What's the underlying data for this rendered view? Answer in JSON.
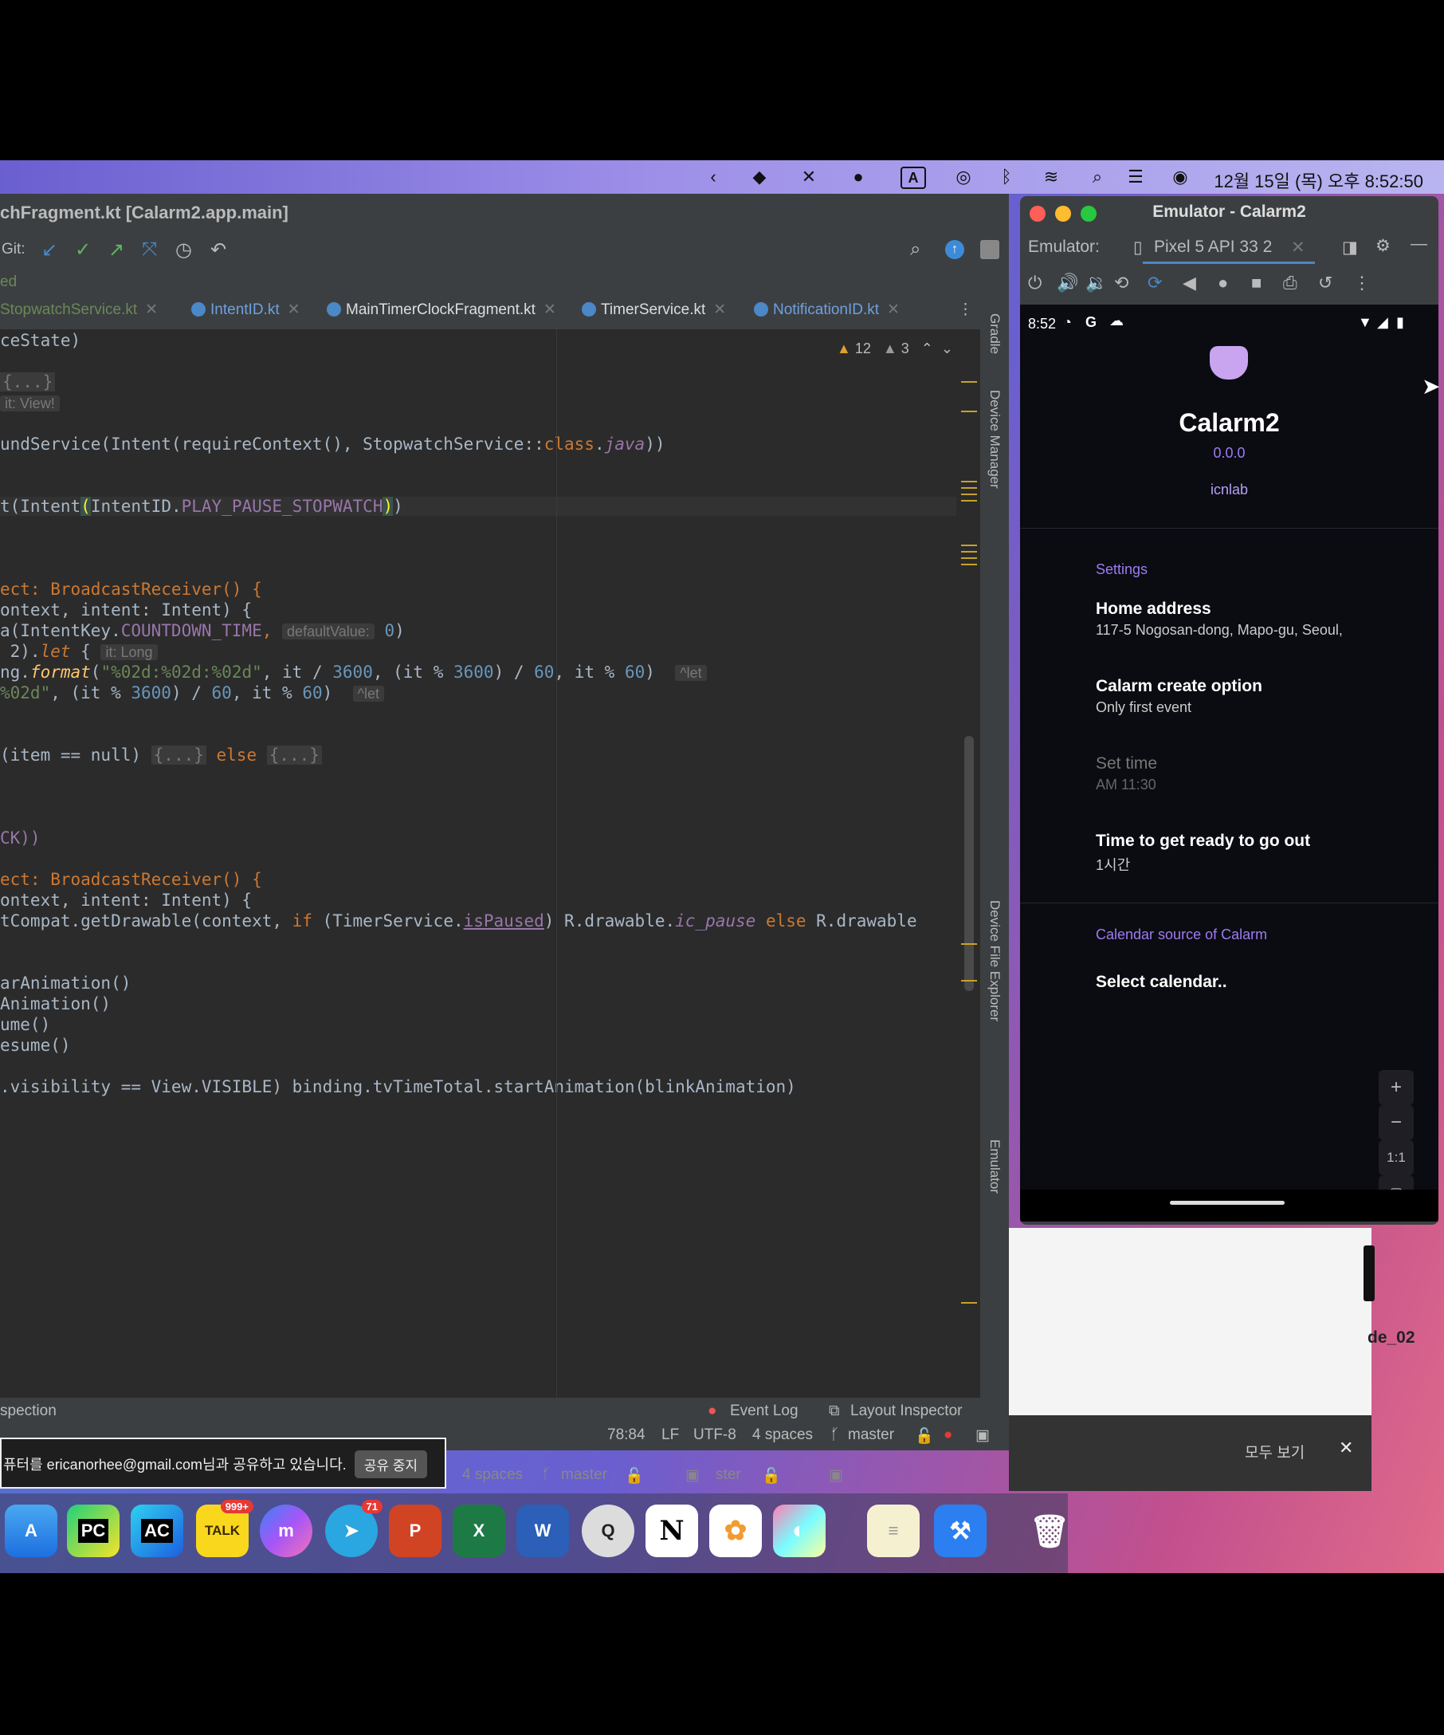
{
  "menubar": {
    "clock": "12월 15일 (목) 오후 8:52:50",
    "icons": [
      "chevron-left-icon",
      "shield-icon",
      "mute-icon",
      "chat-icon",
      "input-source-icon",
      "airdrop-icon",
      "bluetooth-icon",
      "wifi-icon",
      "search-icon",
      "control-center-icon",
      "siri-icon"
    ],
    "input_source_label": "A"
  },
  "ide": {
    "title": "chFragment.kt [Calarm2.app.main]",
    "git_label": "Git:",
    "branch_hint": "ed",
    "tabs": [
      {
        "label": "StopwatchService.kt"
      },
      {
        "label": "IntentID.kt"
      },
      {
        "label": "MainTimerClockFragment.kt"
      },
      {
        "label": "TimerService.kt"
      },
      {
        "label": "NotificationID.kt"
      }
    ],
    "warnings": "12",
    "weak_warnings": "3",
    "side_tools": [
      "Gradle",
      "Device Manager",
      "Device File Explorer",
      "Emulator"
    ],
    "status": {
      "inspection": "spection",
      "event_log": "Event Log",
      "layout_inspector": "Layout Inspector",
      "position": "78:84",
      "line_sep": "LF",
      "encoding": "UTF-8",
      "indent": "4 spaces",
      "branch": "master"
    },
    "status_ghost": {
      "indent": "4 spaces",
      "branch": "master",
      "branch2": "ster"
    },
    "code": {
      "l1": "ceState)",
      "l2": "{...}",
      "l2_hint": "it: View!",
      "l3a": "undService(Intent(requireContext(), StopwatchService::",
      "l3b": "class",
      "l3c": ".",
      "l3d": "java",
      "l3e": "))",
      "l4a": "t(Intent",
      "l4b": "(",
      "l4c": "IntentID.",
      "l4d": "PLAY_PAUSE_STOPWATCH",
      "l4e": ")",
      "l4f": ")",
      "l5a": "ect: BroadcastReceiver() {",
      "l6a": "ontext, intent: Intent) {",
      "l7a": "a(IntentKey.",
      "l7b": "COUNTDOWN_TIME",
      "l7c": ",",
      "l7_hint": "defaultValue:",
      "l7d": "0",
      "l7e": ")",
      "l8a": " 2).",
      "l8b": "let",
      "l8c": " {",
      "l8_hint": "it: Long",
      "l9a": "ng.",
      "l9b": "format",
      "l9c": "(",
      "l9d": "\"%02d:%02d:%02d\"",
      "l9e": ", it / ",
      "l9f": "3600",
      "l9g": ", (it % ",
      "l9h": "3600",
      "l9i": ") / ",
      "l9j": "60",
      "l9k": ", it % ",
      "l9l": "60",
      "l9m": ")",
      "l9_hint": "^let",
      "l10a": "%02d\"",
      "l10b": ", (it % ",
      "l10c": "3600",
      "l10d": ") / ",
      "l10e": "60",
      "l10f": ", it % ",
      "l10g": "60",
      "l10h": ")",
      "l10_hint": "^let",
      "l11a": "(item == null) ",
      "l11b": "{...}",
      "l11c": " else ",
      "l11d": "{...}",
      "l12a": "CK))",
      "l13a": "ect: BroadcastReceiver() {",
      "l14a": "ontext, intent: Intent) {",
      "l15a": "tCompat.getDrawable(context, ",
      "l15b": "if",
      "l15c": " (TimerService.",
      "l15d": "isPaused",
      "l15e": ") R.drawable.",
      "l15f": "ic_pause",
      "l15g": " else ",
      "l15h": "R.drawable",
      "l16a": "arAnimation()",
      "l17a": "Animation()",
      "l18a": "ume()",
      "l19a": "esume()",
      "l20a": ".visibility == View.VISIBLE) binding.tvTimeTotal.startAnimation(blinkAnimation)"
    }
  },
  "share": {
    "text": "퓨터를 ericanorhee@gmail.com님과 공유하고 있습니다.",
    "stop_label": "공유 중지"
  },
  "bgwin": {
    "label": "de_02",
    "see_all": "모두 보기",
    "close": "✕"
  },
  "emulator": {
    "title": "Emulator - Calarm2",
    "tab_label": "Emulator:",
    "device_tab": "Pixel 5 API 33 2",
    "phone": {
      "time": "8:52",
      "app_name": "Calarm2",
      "version": "0.0.0",
      "brand": "icnlab",
      "settings_header": "Settings",
      "home_title": "Home address",
      "home_value": "117-5 Nogosan-dong, Mapo-gu, Seoul,",
      "option_title": "Calarm create option",
      "option_value": "Only first event",
      "settime_title": "Set time",
      "settime_value": "AM 11:30",
      "ready_title": "Time to get ready to go out",
      "ready_value": "1시간",
      "calendar_header": "Calendar source of Calarm",
      "calendar_select": "Select calendar..",
      "zoom_in": "+",
      "zoom_out": "−",
      "zoom_reset": "1:1"
    }
  },
  "dock": {
    "apps": [
      {
        "name": "app-store",
        "label": "A"
      },
      {
        "name": "pycharm",
        "label": "PC"
      },
      {
        "name": "appcode",
        "label": "AC"
      },
      {
        "name": "kakaotalk",
        "label": "TALK",
        "badge": "999+"
      },
      {
        "name": "messenger",
        "label": "m"
      },
      {
        "name": "telegram",
        "label": "➤",
        "badge": "71"
      },
      {
        "name": "powerpoint",
        "label": "P"
      },
      {
        "name": "excel",
        "label": "X"
      },
      {
        "name": "word",
        "label": "W"
      },
      {
        "name": "quicktime",
        "label": "Q"
      },
      {
        "name": "notion",
        "label": "N"
      },
      {
        "name": "photos",
        "label": "✿"
      },
      {
        "name": "arc",
        "label": "◐"
      },
      {
        "name": "notes",
        "label": "≡"
      },
      {
        "name": "xcode",
        "label": "⚒"
      },
      {
        "name": "trash",
        "label": "🗑"
      }
    ]
  }
}
